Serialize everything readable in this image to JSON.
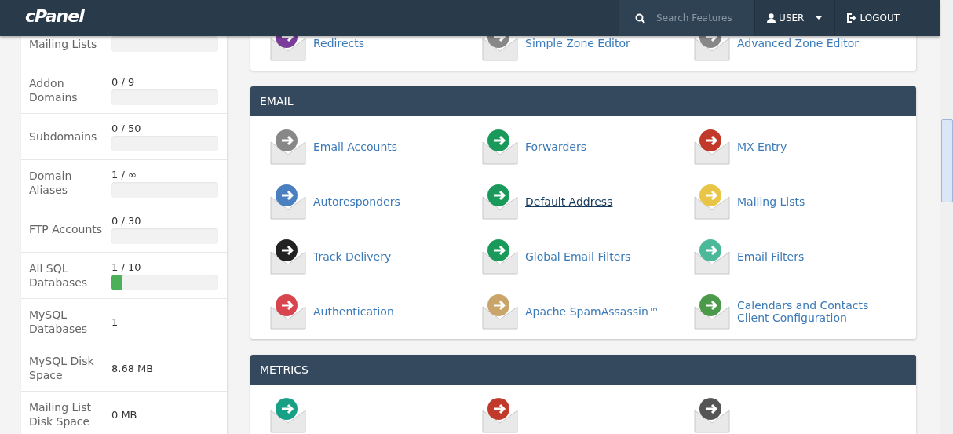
{
  "header": {
    "logo": "cPanel",
    "search": {
      "placeholder": "Search Features"
    },
    "user_menu": "USER",
    "logout": "LOGOUT"
  },
  "sidebar": {
    "stats": [
      {
        "label": "Mailing Lists",
        "level": 0
      },
      {
        "label": "Addon Domains",
        "value": "0 / 9",
        "level": 0
      },
      {
        "label": "Subdomains",
        "value": "0 / 50",
        "level": 0
      },
      {
        "label": "Domain Aliases",
        "value": "1 / ∞",
        "level": 0
      },
      {
        "label": "FTP Accounts",
        "value": "0 / 30",
        "level": 0
      },
      {
        "label": "All SQL Databases",
        "value": "1 / 10",
        "level": 0.1
      },
      {
        "label": "MySQL Databases",
        "value": "1"
      },
      {
        "label": "MySQL Disk Space",
        "value": "8.68 MB"
      },
      {
        "label": "Mailing List Disk Space",
        "value": "0 MB"
      }
    ]
  },
  "sections": [
    {
      "items": [
        {
          "label": "Redirects",
          "hovered": false
        },
        {
          "label": "Simple Zone Editor",
          "hovered": false
        },
        {
          "label": "Advanced Zone Editor",
          "hovered": false
        }
      ]
    },
    {
      "title": "EMAIL",
      "items": [
        {
          "label": "Email Accounts",
          "hovered": false
        },
        {
          "label": "Forwarders",
          "hovered": false
        },
        {
          "label": "MX Entry",
          "hovered": false
        },
        {
          "label": "Autoresponders",
          "hovered": false
        },
        {
          "label": "Default Address",
          "hovered": true
        },
        {
          "label": "Mailing Lists",
          "hovered": false
        },
        {
          "label": "Track Delivery",
          "hovered": false
        },
        {
          "label": "Global Email Filters",
          "hovered": false
        },
        {
          "label": "Email Filters",
          "hovered": false
        },
        {
          "label": "Authentication",
          "hovered": false
        },
        {
          "label": "Apache SpamAssassin™",
          "hovered": false
        },
        {
          "label": "Calendars and Contacts Client Configuration",
          "hovered": false
        }
      ]
    },
    {
      "title": "METRICS"
    }
  ]
}
